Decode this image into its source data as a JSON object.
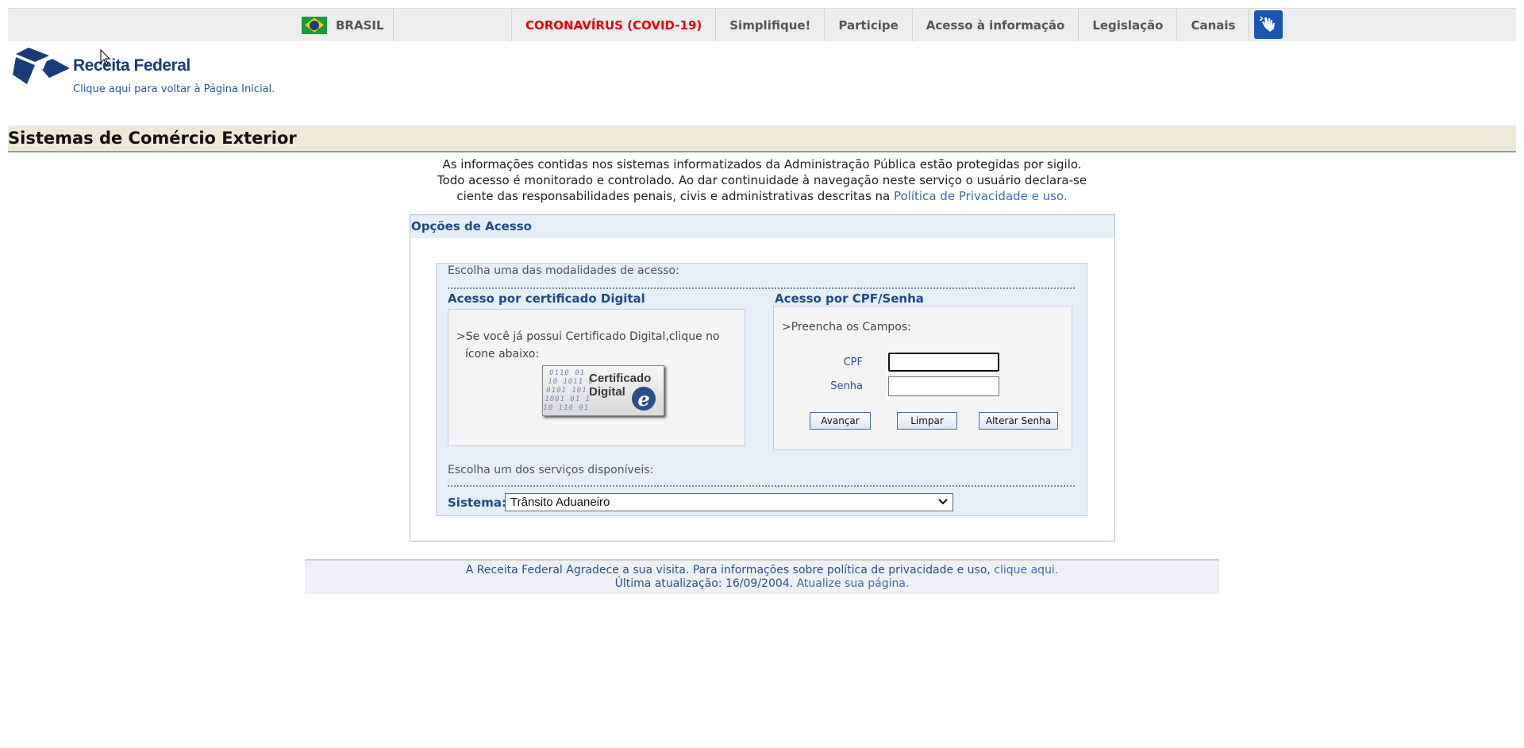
{
  "govbar": {
    "country": "BRASIL",
    "items": [
      "CORONAVÍRUS (COVID-19)",
      "Simplifique!",
      "Participe",
      "Acesso à informação",
      "Legislação",
      "Canais"
    ],
    "covid_color": "#e60000",
    "libras_icon": "hand-sign-language-icon"
  },
  "logo": {
    "title": "Receita Federal",
    "subtitle": "Clique aqui para voltar à Página Inicial."
  },
  "page_title": "Sistemas de Comércio Exterior",
  "notice": {
    "line1": "As informações contidas nos sistemas informatizados da Administração Pública estão protegidas por sigilo.",
    "line2": "Todo acesso é monitorado e controlado. Ao dar continuidade à navegação neste serviço o usuário declara-se",
    "line3": "ciente das responsabilidades penais, civis e administrativas descritas na",
    "link": "Política de Privacidade e uso."
  },
  "panel": {
    "title": "Opções de Acesso",
    "choose_mode": "Escolha uma das modalidades de acesso:",
    "cert": {
      "title": "Acesso por certificado Digital",
      "text1": ">Se você já possui Certificado Digital,clique no",
      "text2": "ícone abaixo:",
      "button_line1": "Certificado",
      "button_line2": "Digital",
      "button_mark": "e"
    },
    "cpf": {
      "title": "Acesso por CPF/Senha",
      "prompt": ">Preencha os Campos:",
      "cpf_label": "CPF",
      "cpf_value": "",
      "senha_label": "Senha",
      "senha_value": "",
      "btn_avancar": "Avançar",
      "btn_limpar": "Limpar",
      "btn_alterar": "Alterar Senha"
    },
    "choose_service": "Escolha um dos serviços disponíveis:",
    "sistema_label": "Sistema:",
    "sistema_value": "Trânsito Aduaneiro"
  },
  "footer": {
    "line1": "A Receita Federal Agradece a sua visita. Para informações sobre política de privacidade e uso,",
    "link1": "clique aqui.",
    "line2": "Última atualização: 16/09/2004.",
    "link2": "Atualize sua página."
  }
}
